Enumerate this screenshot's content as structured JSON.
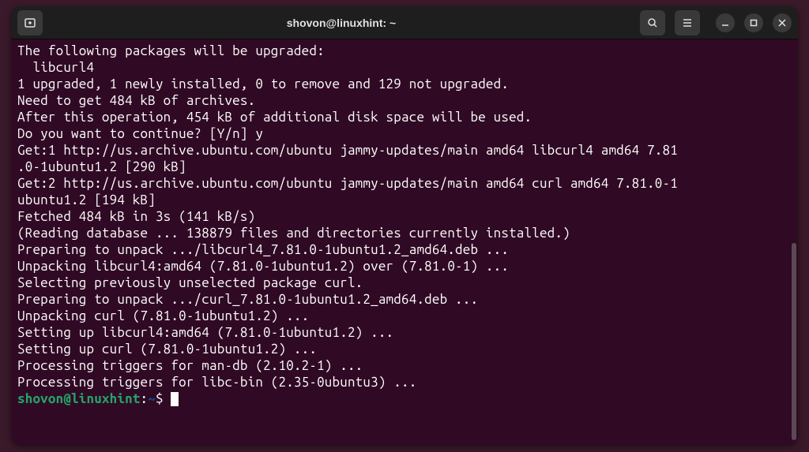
{
  "titlebar": {
    "title": "shovon@linuxhint: ~"
  },
  "terminal": {
    "lines": [
      "The following packages will be upgraded:",
      "  libcurl4",
      "1 upgraded, 1 newly installed, 0 to remove and 129 not upgraded.",
      "Need to get 484 kB of archives.",
      "After this operation, 454 kB of additional disk space will be used.",
      "Do you want to continue? [Y/n] y",
      "Get:1 http://us.archive.ubuntu.com/ubuntu jammy-updates/main amd64 libcurl4 amd64 7.81",
      ".0-1ubuntu1.2 [290 kB]",
      "Get:2 http://us.archive.ubuntu.com/ubuntu jammy-updates/main amd64 curl amd64 7.81.0-1",
      "ubuntu1.2 [194 kB]",
      "Fetched 484 kB in 3s (141 kB/s)",
      "(Reading database ... 138879 files and directories currently installed.)",
      "Preparing to unpack .../libcurl4_7.81.0-1ubuntu1.2_amd64.deb ...",
      "Unpacking libcurl4:amd64 (7.81.0-1ubuntu1.2) over (7.81.0-1) ...",
      "Selecting previously unselected package curl.",
      "Preparing to unpack .../curl_7.81.0-1ubuntu1.2_amd64.deb ...",
      "Unpacking curl (7.81.0-1ubuntu1.2) ...",
      "Setting up libcurl4:amd64 (7.81.0-1ubuntu1.2) ...",
      "Setting up curl (7.81.0-1ubuntu1.2) ...",
      "Processing triggers for man-db (2.10.2-1) ...",
      "Processing triggers for libc-bin (2.35-0ubuntu3) ..."
    ],
    "prompt": {
      "user_host": "shovon@linuxhint",
      "path": "~",
      "symbol": "$"
    }
  }
}
